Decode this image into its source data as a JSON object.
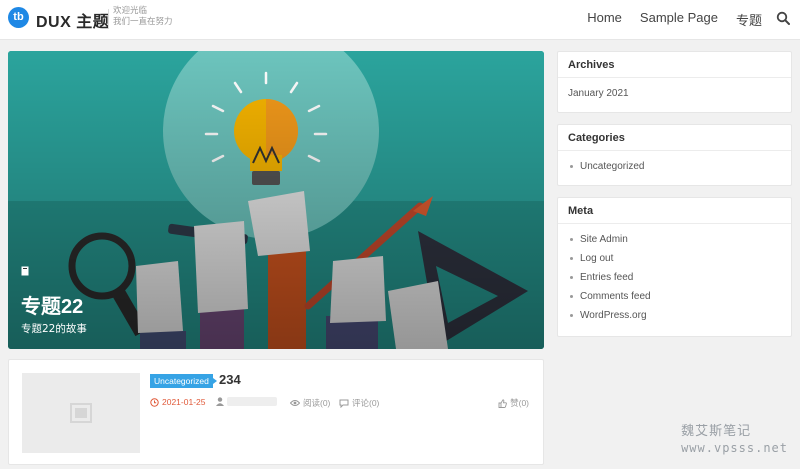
{
  "header": {
    "logo_mark": "tb",
    "logo_text": "DUX 主题",
    "tagline_line1": "欢迎光临",
    "tagline_line2": "我们一直在努力",
    "nav": [
      "Home",
      "Sample Page",
      "专题"
    ]
  },
  "hero": {
    "count": "1",
    "title": "专题22",
    "description": "专题22的故事"
  },
  "sidebar": {
    "archives": {
      "title": "Archives",
      "items": [
        "January 2021"
      ]
    },
    "categories": {
      "title": "Categories",
      "items": [
        "Uncategorized"
      ]
    },
    "meta": {
      "title": "Meta",
      "items": [
        "Site Admin",
        "Log out",
        "Entries feed",
        "Comments feed",
        "WordPress.org"
      ]
    }
  },
  "post": {
    "category": "Uncategorized",
    "title": "234",
    "date": "2021-01-25",
    "views": "阅读(0)",
    "comments": "评论(0)",
    "likes": "赞(0)"
  },
  "watermark": {
    "line1": "魏艾斯笔记",
    "line2": "www.vpsss.net"
  },
  "colors": {
    "accent": "#1e88e5",
    "tag": "#36a3e5",
    "date": "#e05a3a",
    "hero_bg": "#2aa39c"
  },
  "icons": [
    "search-icon",
    "book-icon",
    "clock-icon",
    "user-icon",
    "eye-icon",
    "comment-icon",
    "thumbs-up-icon",
    "image-placeholder-icon"
  ]
}
